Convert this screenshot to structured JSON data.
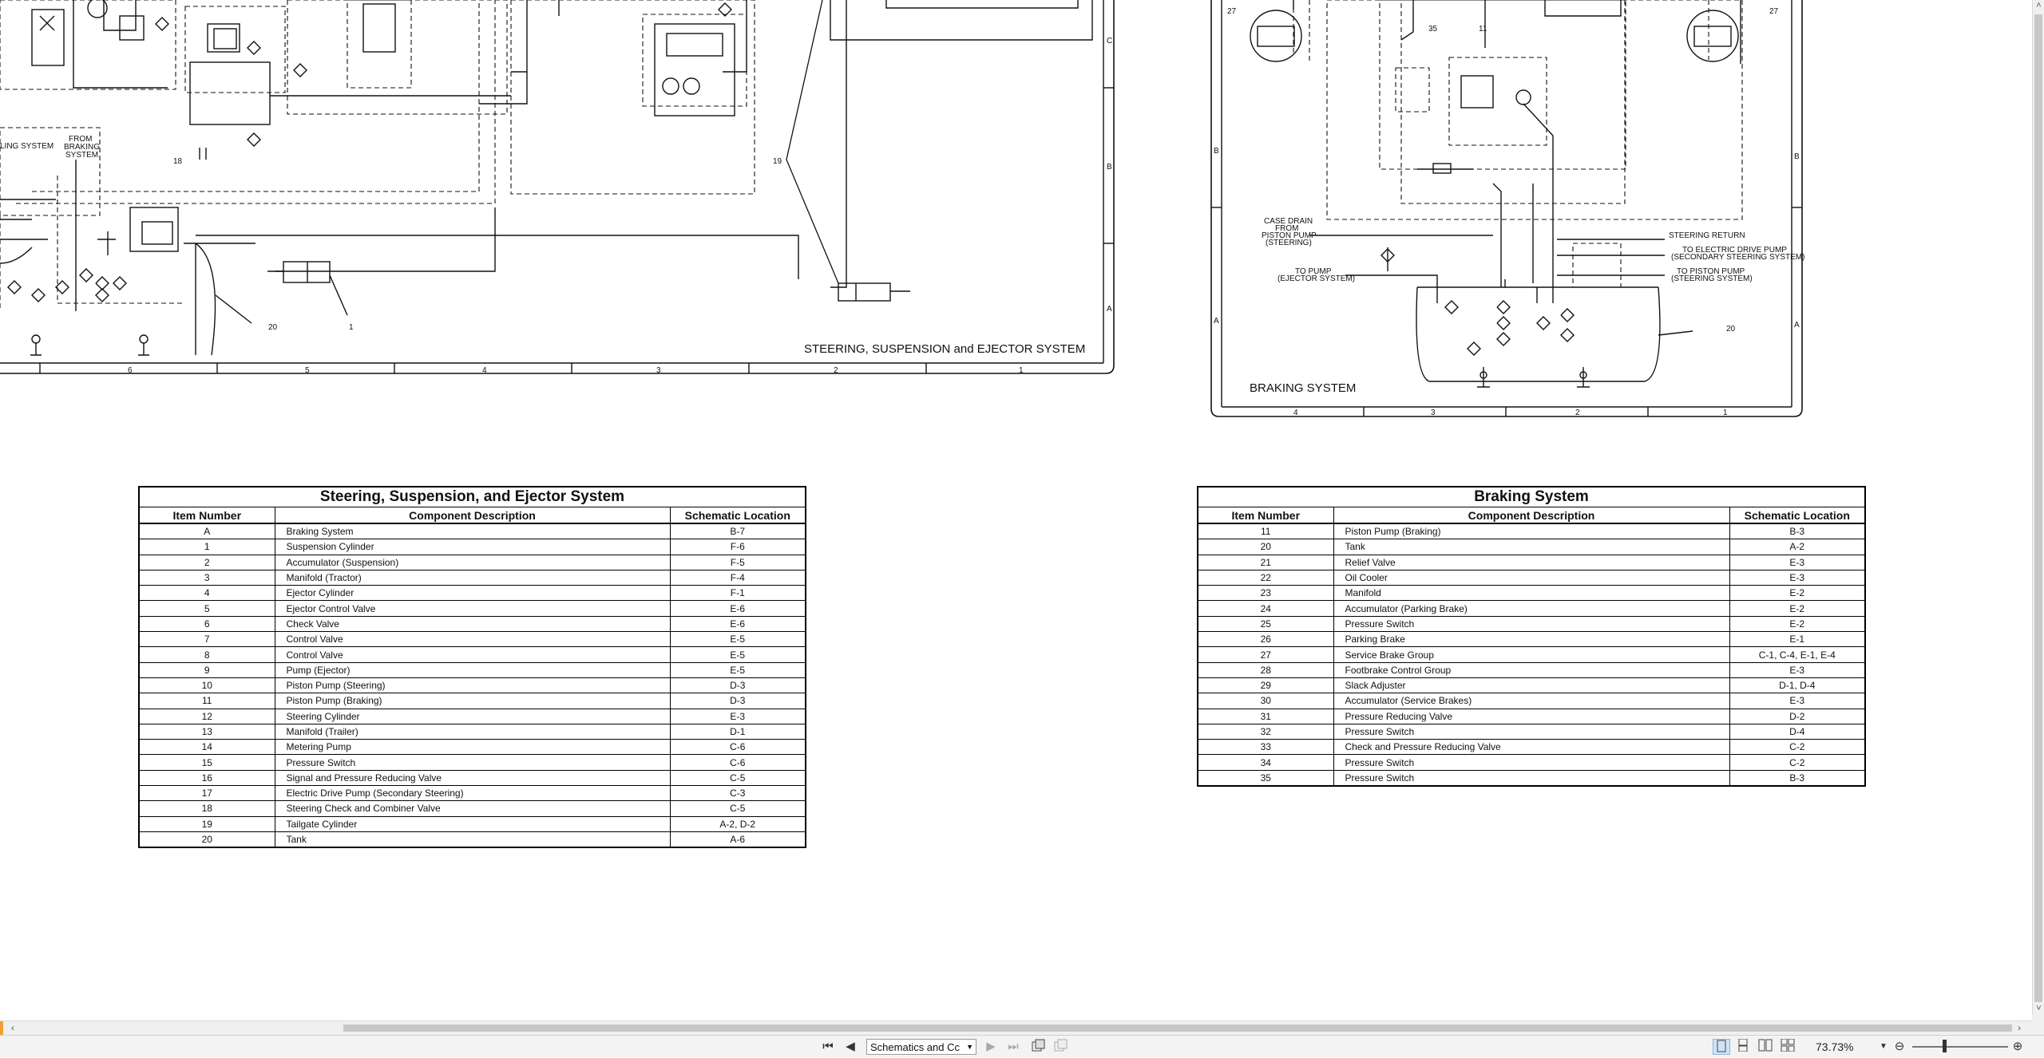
{
  "schematic": {
    "left_title": "STEERING, SUSPENSION and EJECTOR SYSTEM",
    "right_title": "BRAKING SYSTEM",
    "left_labels": {
      "from_braking": [
        "FROM",
        "BRAKING",
        "SYSTEM"
      ],
      "braking_partial": "LING SYSTEM",
      "callout_18": "18",
      "callout_19": "19",
      "callout_20": "20",
      "callout_1": "1",
      "zone_c": "C",
      "zone_b": "B",
      "zone_a": "A"
    },
    "left_ruler": [
      "6",
      "5",
      "4",
      "3",
      "2",
      "1"
    ],
    "right_labels": {
      "callout_27a": "27",
      "callout_27b": "27",
      "callout_35": "35",
      "callout_11": "11",
      "callout_20": "20",
      "case_drain": [
        "CASE DRAIN",
        "FROM",
        "PISTON PUMP",
        "(STEERING)"
      ],
      "to_pump_ejector": [
        "TO PUMP",
        "(EJECTOR SYSTEM)"
      ],
      "steering_return": "STEERING RETURN",
      "to_electric_drive": [
        "TO ELECTRIC DRIVE PUMP",
        "(SECONDARY STEERING SYSTEM)"
      ],
      "to_piston_pump": [
        "TO PISTON PUMP",
        "(STEERING SYSTEM)"
      ],
      "zone_b_left": "B",
      "zone_a_left": "A",
      "zone_b_right": "B",
      "zone_a_right": "A"
    },
    "right_ruler": [
      "4",
      "3",
      "2",
      "1"
    ]
  },
  "table_left": {
    "title": "Steering, Suspension, and Ejector System",
    "headers": [
      "Item Number",
      "Component Description",
      "Schematic Location"
    ],
    "rows": [
      [
        "A",
        "Braking System",
        "B-7"
      ],
      [
        "1",
        "Suspension Cylinder",
        "F-6"
      ],
      [
        "2",
        "Accumulator (Suspension)",
        "F-5"
      ],
      [
        "3",
        "Manifold (Tractor)",
        "F-4"
      ],
      [
        "4",
        "Ejector Cylinder",
        "F-1"
      ],
      [
        "5",
        "Ejector Control Valve",
        "E-6"
      ],
      [
        "6",
        "Check Valve",
        "E-6"
      ],
      [
        "7",
        "Control Valve",
        "E-5"
      ],
      [
        "8",
        "Control Valve",
        "E-5"
      ],
      [
        "9",
        "Pump (Ejector)",
        "E-5"
      ],
      [
        "10",
        "Piston Pump (Steering)",
        "D-3"
      ],
      [
        "11",
        "Piston Pump (Braking)",
        "D-3"
      ],
      [
        "12",
        "Steering Cylinder",
        "E-3"
      ],
      [
        "13",
        "Manifold (Trailer)",
        "D-1"
      ],
      [
        "14",
        "Metering Pump",
        "C-6"
      ],
      [
        "15",
        "Pressure Switch",
        "C-6"
      ],
      [
        "16",
        "Signal and Pressure Reducing Valve",
        "C-5"
      ],
      [
        "17",
        "Electric Drive Pump (Secondary Steering)",
        "C-3"
      ],
      [
        "18",
        "Steering Check and Combiner Valve",
        "C-5"
      ],
      [
        "19",
        "Tailgate Cylinder",
        "A-2, D-2"
      ],
      [
        "20",
        "Tank",
        "A-6"
      ]
    ]
  },
  "table_right": {
    "title": "Braking System",
    "headers": [
      "Item Number",
      "Component Description",
      "Schematic Location"
    ],
    "rows": [
      [
        "11",
        "Piston Pump (Braking)",
        "B-3"
      ],
      [
        "20",
        "Tank",
        "A-2"
      ],
      [
        "21",
        "Relief Valve",
        "E-3"
      ],
      [
        "22",
        "Oil Cooler",
        "E-3"
      ],
      [
        "23",
        "Manifold",
        "E-2"
      ],
      [
        "24",
        "Accumulator (Parking Brake)",
        "E-2"
      ],
      [
        "25",
        "Pressure Switch",
        "E-2"
      ],
      [
        "26",
        "Parking Brake",
        "E-1"
      ],
      [
        "27",
        "Service Brake Group",
        "C-1, C-4, E-1, E-4"
      ],
      [
        "28",
        "Footbrake Control Group",
        "E-3"
      ],
      [
        "29",
        "Slack Adjuster",
        "D-1, D-4"
      ],
      [
        "30",
        "Accumulator (Service Brakes)",
        "E-3"
      ],
      [
        "31",
        "Pressure Reducing Valve",
        "D-2"
      ],
      [
        "32",
        "Pressure Switch",
        "D-4"
      ],
      [
        "33",
        "Check and Pressure Reducing Valve",
        "C-2"
      ],
      [
        "34",
        "Pressure Switch",
        "C-2"
      ],
      [
        "35",
        "Pressure Switch",
        "B-3"
      ]
    ]
  },
  "statusbar": {
    "page_select_value": "Schematics and Cc",
    "zoom_value": "73.73%",
    "first_page": "⏮",
    "prev_page": "◀",
    "next_page": "▶",
    "last_page": "⏭"
  }
}
